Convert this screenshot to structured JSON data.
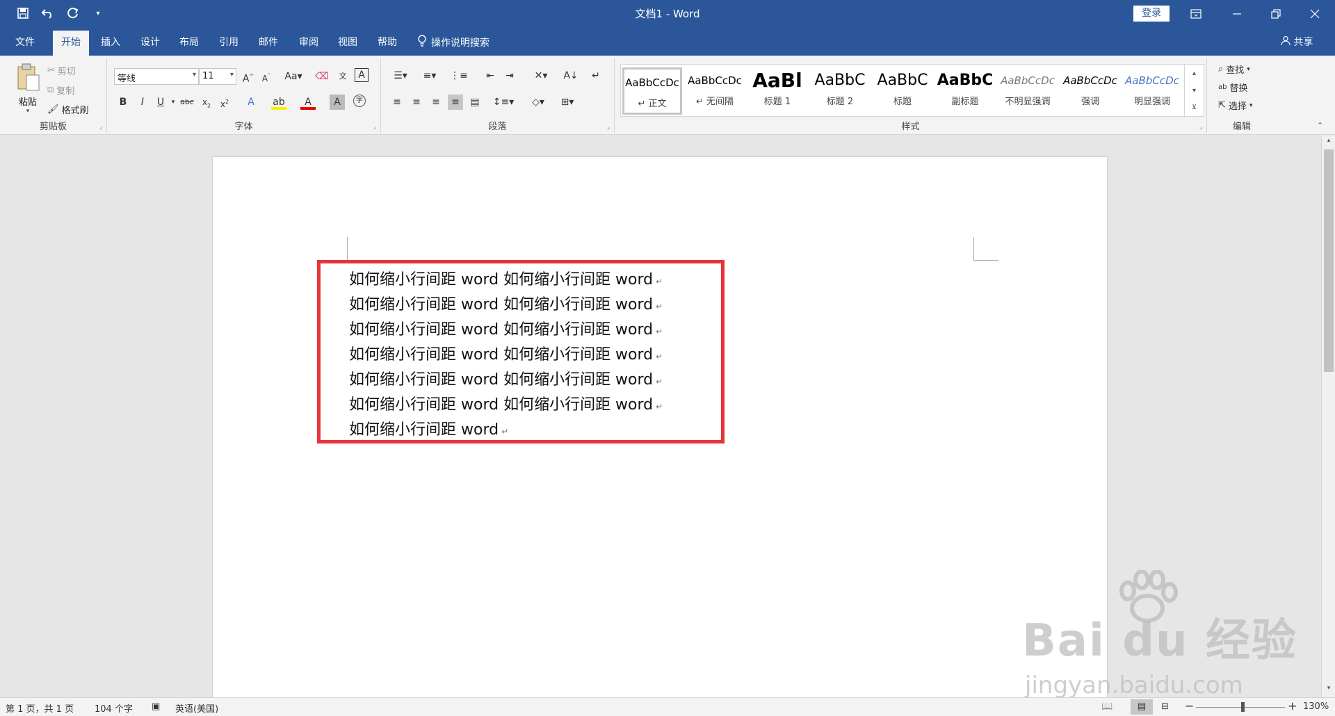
{
  "window": {
    "title": "文档1 - Word",
    "login_label": "登录",
    "controls": [
      "ribbon-display",
      "minimize",
      "restore",
      "close"
    ]
  },
  "quick_access": [
    "save-icon",
    "undo-icon",
    "redo-icon",
    "customize-icon"
  ],
  "tabs": [
    {
      "label": "文件"
    },
    {
      "label": "开始",
      "active": true
    },
    {
      "label": "插入"
    },
    {
      "label": "设计"
    },
    {
      "label": "布局"
    },
    {
      "label": "引用"
    },
    {
      "label": "邮件"
    },
    {
      "label": "审阅"
    },
    {
      "label": "视图"
    },
    {
      "label": "帮助"
    }
  ],
  "tell_me": "操作说明搜索",
  "share_label": "共享",
  "ribbon": {
    "clipboard": {
      "label": "剪贴板",
      "paste": "粘贴",
      "cut": "剪切",
      "copy": "复制",
      "format_painter": "格式刷"
    },
    "font": {
      "label": "字体",
      "font_name": "等线",
      "font_size": "11"
    },
    "paragraph": {
      "label": "段落"
    },
    "styles": {
      "label": "样式",
      "items": [
        {
          "sample": "AaBbCcDc",
          "name": "正文",
          "selected": true
        },
        {
          "sample": "AaBbCcDc",
          "name": "无间隔"
        },
        {
          "sample": "AaBl",
          "name": "标题 1"
        },
        {
          "sample": "AaBbC",
          "name": "标题 2"
        },
        {
          "sample": "AaBbC",
          "name": "标题"
        },
        {
          "sample": "AaBbC",
          "name": "副标题"
        },
        {
          "sample": "AaBbCcDc",
          "name": "不明显强调"
        },
        {
          "sample": "AaBbCcDc",
          "name": "强调"
        },
        {
          "sample": "AaBbCcDc",
          "name": "明显强调"
        }
      ]
    },
    "editing": {
      "label": "编辑",
      "find": "查找",
      "replace": "替换",
      "select": "选择"
    }
  },
  "document": {
    "lines": [
      "如何缩小行间距 word 如何缩小行间距 word",
      "如何缩小行间距 word 如何缩小行间距 word",
      "如何缩小行间距 word 如何缩小行间距 word",
      "如何缩小行间距 word 如何缩小行间距 word",
      "如何缩小行间距 word 如何缩小行间距 word",
      "如何缩小行间距 word 如何缩小行间距 word",
      "如何缩小行间距 word"
    ],
    "paragraph_mark": "↵",
    "highlight_color": "#e8333a"
  },
  "watermark": {
    "brand": "Bai du 经验",
    "url": "jingyan.baidu.com"
  },
  "status": {
    "page": "第 1 页，共 1 页",
    "word_count": "104 个字",
    "language": "英语(美国)",
    "zoom": "130%"
  },
  "colors": {
    "accent": "#2b579a",
    "ribbon_bg": "#f3f3f3",
    "canvas_bg": "#e6e6e6"
  }
}
